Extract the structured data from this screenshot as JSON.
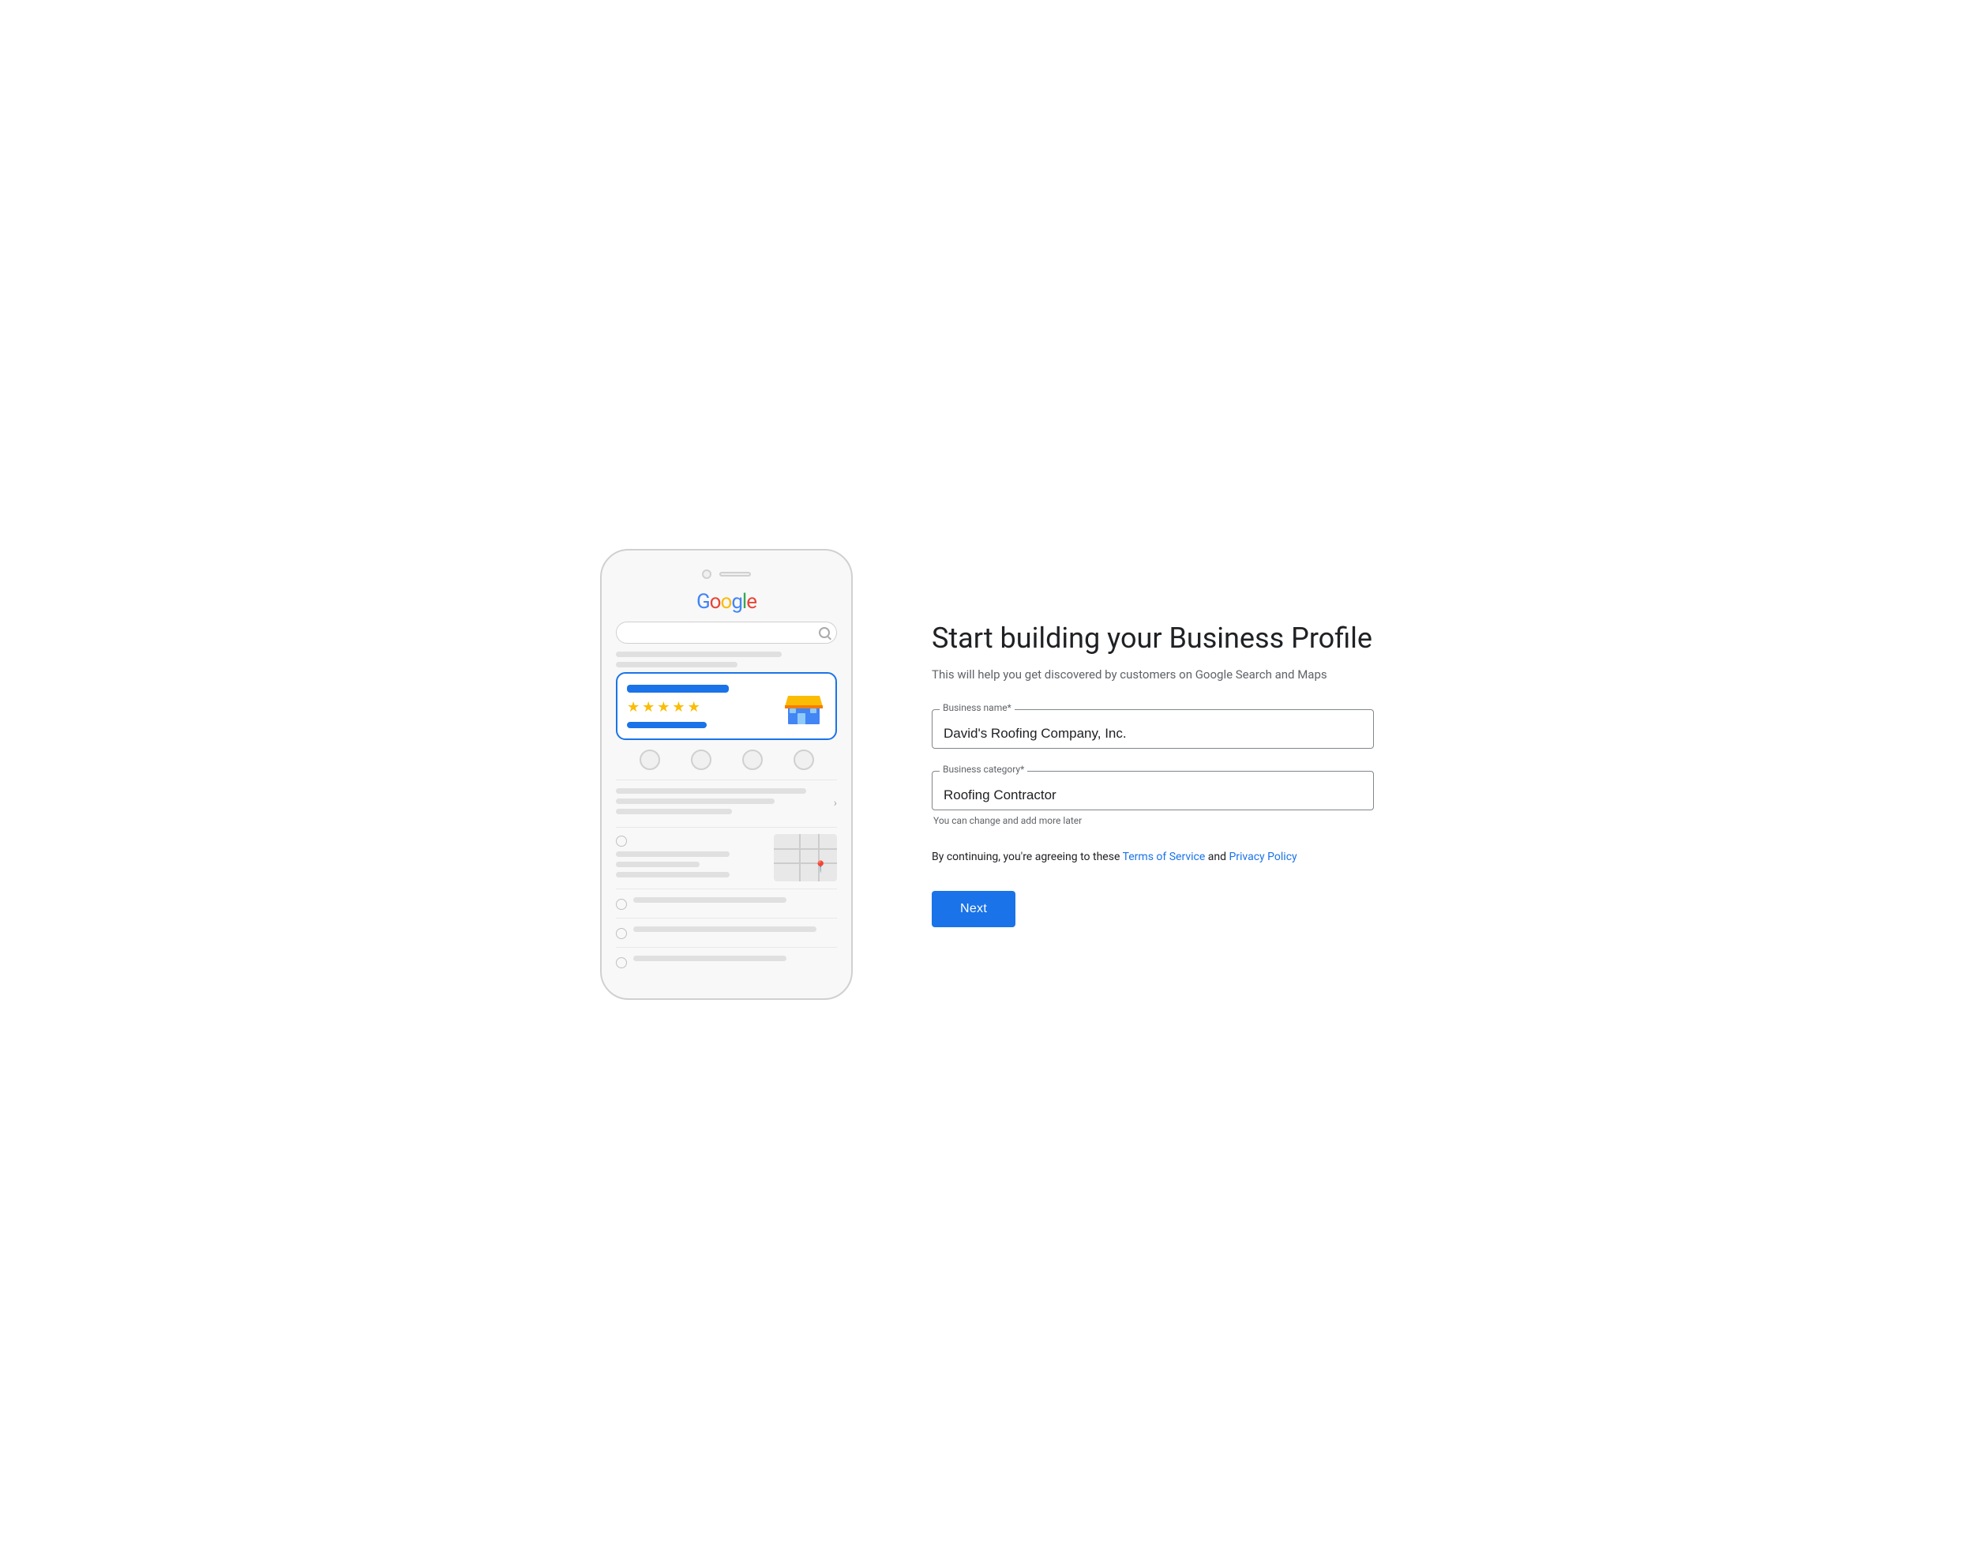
{
  "page": {
    "title": "Start building your Business Profile",
    "subtitle": "This will help you get discovered by customers on Google Search and Maps"
  },
  "form": {
    "business_name_label": "Business name*",
    "business_name_value": "David's Roofing Company, Inc.",
    "business_category_label": "Business category*",
    "business_category_value": "Roofing Contractor",
    "category_hint": "You can change and add more later",
    "terms_prefix": "By continuing, you're agreeing to these ",
    "terms_link": "Terms of Service",
    "terms_and": " and ",
    "privacy_link": "Privacy Policy",
    "next_button": "Next"
  },
  "phone": {
    "google_logo": "Google",
    "stars": [
      "★",
      "★",
      "★",
      "★",
      "★"
    ]
  }
}
